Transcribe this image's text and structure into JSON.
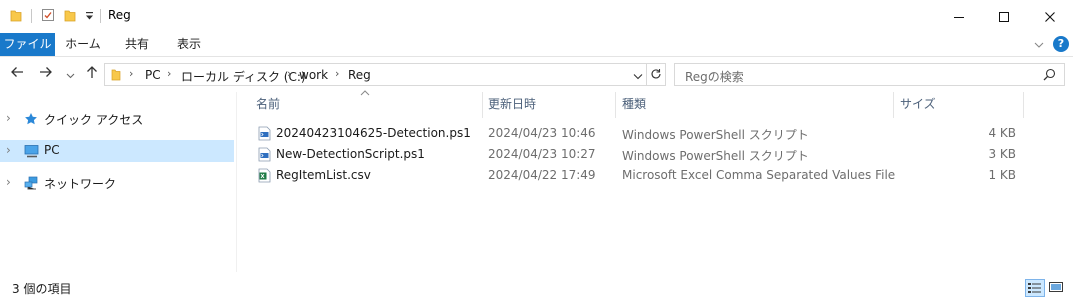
{
  "window": {
    "title": "Reg",
    "minimize_glyph": "─",
    "maximize_glyph": "☐",
    "close_glyph": "✕"
  },
  "ribbon": {
    "tabs": [
      {
        "label": "ファイル",
        "active": true
      },
      {
        "label": "ホーム"
      },
      {
        "label": "共有"
      },
      {
        "label": "表示"
      }
    ],
    "help_glyph": "?"
  },
  "address": {
    "back": "←",
    "forward": "→",
    "recent": "⌄",
    "up": "↑",
    "crumbs": [
      "PC",
      "ローカル ディスク (C:)",
      "work",
      "Reg"
    ],
    "search_placeholder": "Regの検索"
  },
  "nav": {
    "items": [
      {
        "label": "クイック アクセス",
        "icon": "star-icon"
      },
      {
        "label": "PC",
        "icon": "computer-icon",
        "selected": true
      },
      {
        "label": "ネットワーク",
        "icon": "network-icon"
      }
    ]
  },
  "columns": {
    "name": "名前",
    "date": "更新日時",
    "type": "種類",
    "size": "サイズ"
  },
  "files": [
    {
      "name": "20240423104625-Detection.ps1",
      "date": "2024/04/23 10:46",
      "type": "Windows PowerShell スクリプト",
      "size": "4 KB",
      "icon": "powershell-file-icon"
    },
    {
      "name": "New-DetectionScript.ps1",
      "date": "2024/04/23 10:27",
      "type": "Windows PowerShell スクリプト",
      "size": "3 KB",
      "icon": "powershell-file-icon"
    },
    {
      "name": "RegItemList.csv",
      "date": "2024/04/22 17:49",
      "type": "Microsoft Excel Comma Separated Values File",
      "size": "1 KB",
      "icon": "excel-file-icon"
    }
  ],
  "status": {
    "count_text": "3 個の項目"
  },
  "colors": {
    "accent": "#1979ca",
    "selection": "#cce8ff",
    "folder": "#f8c84a"
  }
}
